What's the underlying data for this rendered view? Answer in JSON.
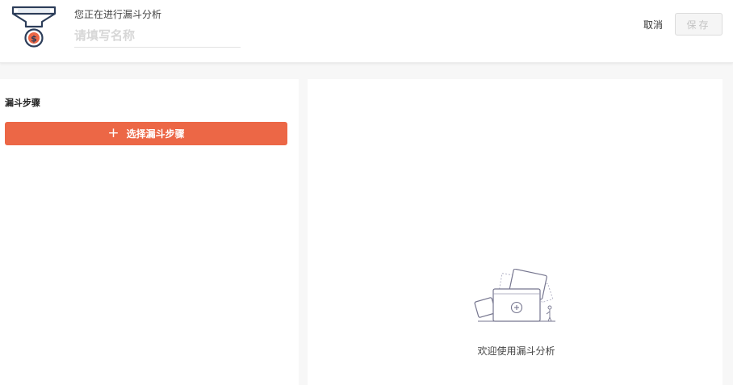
{
  "header": {
    "subtitle": "您正在进行漏斗分析",
    "name_placeholder": "请填写名称",
    "name_value": "",
    "cancel_label": "取消",
    "save_label": "保存"
  },
  "left_panel": {
    "title": "漏斗步骤",
    "add_step_label": "选择漏斗步骤",
    "add_step_icon": "plus-icon"
  },
  "right_panel": {
    "empty_text": "欢迎使用漏斗分析",
    "empty_icon": "empty-folder-illustration"
  },
  "colors": {
    "accent": "#ec6746",
    "logo_navy": "#2d3e5a",
    "logo_orange": "#ec6746",
    "disabled_text": "#c3c3c3"
  }
}
